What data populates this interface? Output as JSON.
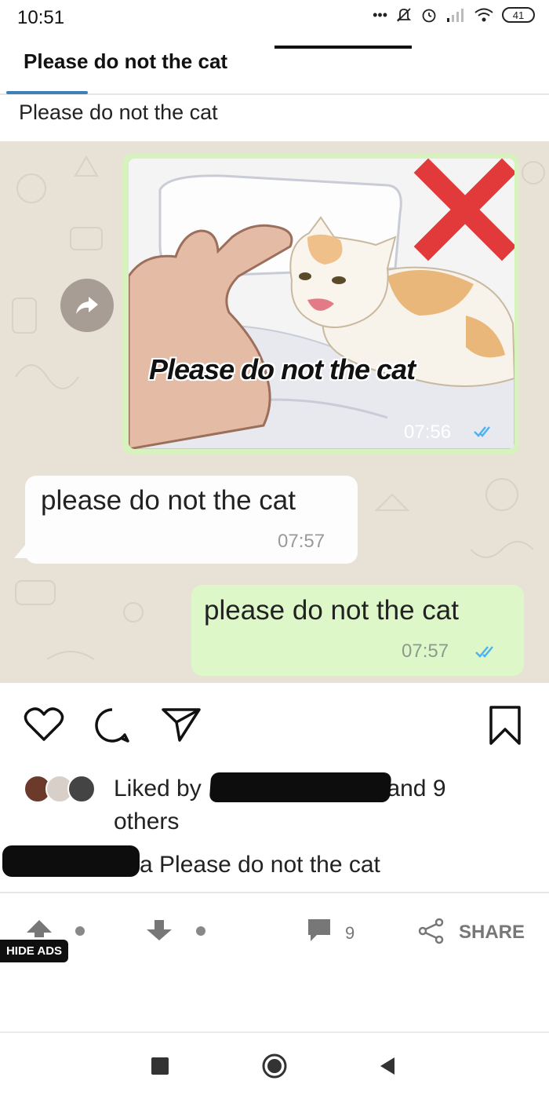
{
  "status_bar": {
    "time": "10:51",
    "battery": "41",
    "dots": "•••"
  },
  "header": {
    "title": "Please do not the cat"
  },
  "post": {
    "subtitle": "Please do not the cat"
  },
  "chat": {
    "image_message": {
      "caption": "Please do not the cat",
      "time": "07:56"
    },
    "incoming": {
      "text": "please do not the cat",
      "time": "07:57"
    },
    "outgoing": {
      "text": "please do not the cat",
      "time": "07:57"
    }
  },
  "instagram": {
    "liked_prefix": "Liked by",
    "liked_suffix": "and 9 others",
    "caption_end": "a Please do not the cat"
  },
  "bottom_bar": {
    "comment_count": "9",
    "share_label": "SHARE",
    "hide_ads": "HIDE ADS"
  },
  "icons": [
    "heart-icon",
    "comment-icon",
    "send-icon",
    "bookmark-icon",
    "upvote-icon",
    "downvote-icon",
    "comment-bubble-icon",
    "share-icon",
    "forward-icon"
  ],
  "colors": {
    "bubble_out": "#ddf7c8",
    "bubble_in": "#fdfdfd",
    "chat_bg": "#e8e1d6",
    "tick_blue": "#4fb3f0"
  }
}
